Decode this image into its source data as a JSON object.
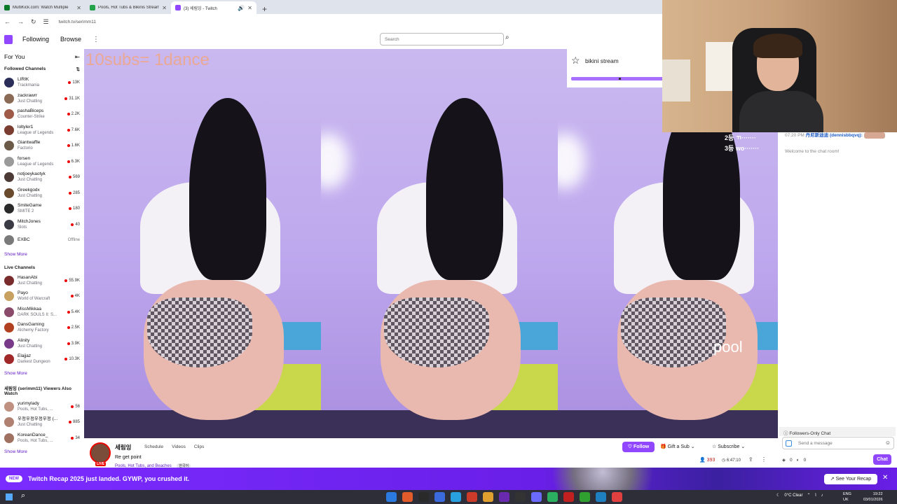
{
  "browser": {
    "tabs": [
      {
        "title": "MultiKick.com: Watch Multiple",
        "color": "#0a7a2a"
      },
      {
        "title": "Pools, Hot Tubs & Bikinis Stream",
        "color": "#22a34a"
      },
      {
        "title": "(3) 세림잉 - Twitch",
        "color": "#9147ff"
      }
    ],
    "new_tab": "+",
    "url": "twitch.tv/serimm11"
  },
  "nav": {
    "following": "Following",
    "browse": "Browse",
    "search_placeholder": "Search"
  },
  "sidebar": {
    "for_you": "For You",
    "followed_title": "Followed Channels",
    "followed": [
      {
        "name": "LIRIK",
        "game": "Trackmania",
        "count": "13K",
        "color": "#2a2d57"
      },
      {
        "name": "zackrawrr",
        "game": "Just Chatting",
        "count": "31.1K",
        "color": "#8a6a55"
      },
      {
        "name": "pashaBiceps",
        "game": "Counter-Strike",
        "count": "2.2K",
        "color": "#a05a48"
      },
      {
        "name": "loltyler1",
        "game": "League of Legends",
        "count": "7.6K",
        "color": "#7b3d2f"
      },
      {
        "name": "Giantwaffle",
        "game": "Factorio",
        "count": "1.6K",
        "color": "#6b5a48"
      },
      {
        "name": "forsen",
        "game": "League of Legends",
        "count": "6.3K",
        "color": "#9a9a9a"
      },
      {
        "name": "notjoeykaotyk",
        "game": "Just Chatting",
        "count": "569",
        "color": "#4c3a36"
      },
      {
        "name": "Greekgodx",
        "game": "Just Chatting",
        "count": "285",
        "color": "#6a4a2c"
      },
      {
        "name": "SmiteGame",
        "game": "SMITE 2",
        "count": "180",
        "color": "#2a2a2a"
      },
      {
        "name": "MitchJones",
        "game": "Slots",
        "count": "40",
        "color": "#3a3a44"
      },
      {
        "name": "EXBC",
        "game": "",
        "count": "Offline",
        "color": "#7a7a7a"
      }
    ],
    "show_more": "Show More",
    "live_title": "Live Channels",
    "live": [
      {
        "name": "HasanAbi",
        "game": "Just Chatting",
        "count": "55.9K",
        "color": "#7a2b2b"
      },
      {
        "name": "Payo",
        "game": "World of Warcraft",
        "count": "4K",
        "color": "#c8a060"
      },
      {
        "name": "MissMikkaa",
        "game": "DARK SOULS II: S...",
        "count": "5.4K",
        "color": "#8a4a6a"
      },
      {
        "name": "DansGaming",
        "game": "Alchemy Factory",
        "count": "2.5K",
        "color": "#b04020"
      },
      {
        "name": "Alinity",
        "game": "Just Chatting",
        "count": "3.9K",
        "color": "#7a3a8a"
      },
      {
        "name": "Elajjaz",
        "game": "Darkest Dungeon",
        "count": "10.3K",
        "color": "#a02828"
      }
    ],
    "also_title": "세림잉 (serimm11) Viewers Also Watch",
    "also": [
      {
        "name": "yurimylady",
        "game": "Pools, Hot Tubs, ...",
        "count": "56",
        "color": "#c09080"
      },
      {
        "name": "우정우정우정우정 (...",
        "game": "Just Chatting",
        "count": "885",
        "color": "#b08070"
      },
      {
        "name": "KoreanDance_",
        "game": "Pools, Hot Tubs, ...",
        "count": "34",
        "color": "#a07060"
      }
    ]
  },
  "video": {
    "overlay_text": "10subs= 1dance",
    "pool_text": "pool",
    "rank_lines": [
      "2등  ㄲ·······",
      "3등  wo·······"
    ],
    "card_label": "bikini stream"
  },
  "chat": {
    "time": "07:20 PM",
    "user": "丹尼斯迪迪 (dennisbbqvq):",
    "welcome": "Welcome to the chat room!",
    "followers_only": "Followers-Only Chat",
    "placeholder": "Send a message",
    "points_a": "0",
    "points_b": "0",
    "chat_button": "Chat"
  },
  "stream": {
    "name": "세림잉",
    "tabs": [
      "Schedule",
      "Videos",
      "Clips"
    ],
    "title": "Re get point",
    "category": "Pools, Hot Tubs, and Beaches",
    "language": "한국어",
    "live": "LIVE",
    "follow": "Follow",
    "gift": "Gift a Sub",
    "subscribe": "Subscribe",
    "viewers": "393",
    "uptime": "6:47:10"
  },
  "banner": {
    "badge": "NEW",
    "text": "Twitch Recap 2025 just landed. GYWP, you crushed it.",
    "button": "See Your Recap"
  },
  "taskbar": {
    "weather": "0°C  Clear",
    "lang1": "ENG",
    "lang2": "UK",
    "time": "19:22",
    "date": "03/01/2026",
    "apps": [
      "#2a7adf",
      "#e25b2a",
      "#2a2a2a",
      "#3a6ade",
      "#28a0e0",
      "#cc3a2a",
      "#e0a030",
      "#6a2ab0",
      "#333",
      "#6a6aff",
      "#2ab060",
      "#c02020",
      "#30a030",
      "#1e80c0",
      "#e04040"
    ]
  }
}
